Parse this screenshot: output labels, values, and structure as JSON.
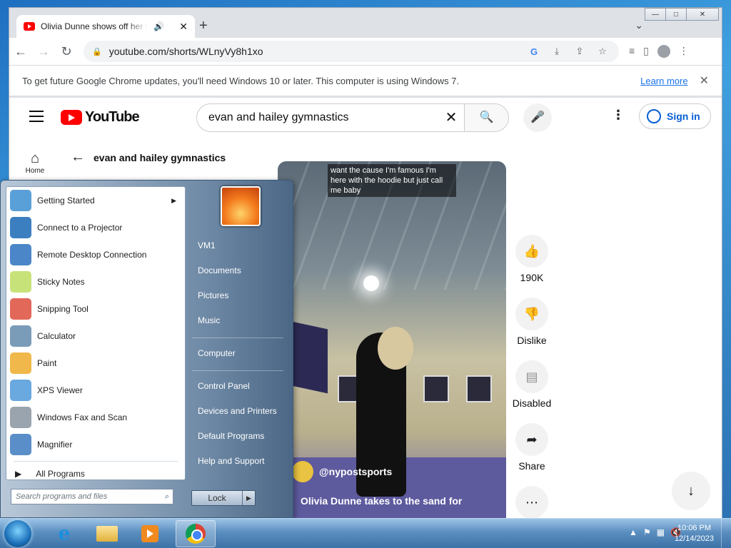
{
  "browser": {
    "tab_title": "Olivia Dunne shows off her w",
    "audio_icon": "🔊",
    "tab_close": "✕",
    "new_tab": "+",
    "tab_search": "⌄",
    "url": "youtube.com/shorts/WLnyVy8h1xo",
    "window_min": "—",
    "window_max": "□",
    "window_close": "✕"
  },
  "infobar": {
    "message": "To get future Google Chrome updates, you'll need Windows 10 or later. This computer is using Windows 7.",
    "learn_more": "Learn more",
    "close": "✕"
  },
  "youtube": {
    "logo_text": "YouTube",
    "search_query": "evan and hailey gymnastics",
    "sign_in": "Sign in",
    "home_label": "Home",
    "back_term": "evan and hailey gymnastics",
    "video": {
      "caption_top": "want the cause I'm famous I'm here with the hoodie but just call me baby",
      "channel": "@nypostsports",
      "title": "Olivia Dunne takes to the sand for"
    },
    "actions": {
      "likes": "190K",
      "dislike": "Dislike",
      "comments": "Disabled",
      "share": "Share"
    }
  },
  "start_menu": {
    "programs": [
      {
        "label": "Getting Started",
        "color": "#5aa0d8",
        "has_sub": true
      },
      {
        "label": "Connect to a Projector",
        "color": "#3b7fc0",
        "has_sub": false
      },
      {
        "label": "Remote Desktop Connection",
        "color": "#4a86c8",
        "has_sub": false
      },
      {
        "label": "Sticky Notes",
        "color": "#c8e27a",
        "has_sub": false
      },
      {
        "label": "Snipping Tool",
        "color": "#e2685a",
        "has_sub": false
      },
      {
        "label": "Calculator",
        "color": "#7a9cb8",
        "has_sub": false
      },
      {
        "label": "Paint",
        "color": "#f0b84a",
        "has_sub": false
      },
      {
        "label": "XPS Viewer",
        "color": "#6aa8e0",
        "has_sub": false
      },
      {
        "label": "Windows Fax and Scan",
        "color": "#9aa4ae",
        "has_sub": false
      },
      {
        "label": "Magnifier",
        "color": "#5a8ec8",
        "has_sub": false
      }
    ],
    "all_programs": "All Programs",
    "search_placeholder": "Search programs and files",
    "right_links_a": [
      "VM1",
      "Documents",
      "Pictures",
      "Music"
    ],
    "right_links_b": [
      "Computer"
    ],
    "right_links_c": [
      "Control Panel",
      "Devices and Printers",
      "Default Programs",
      "Help and Support"
    ],
    "lock": "Lock"
  },
  "taskbar": {
    "time": "10:06 PM",
    "date": "12/14/2023"
  }
}
